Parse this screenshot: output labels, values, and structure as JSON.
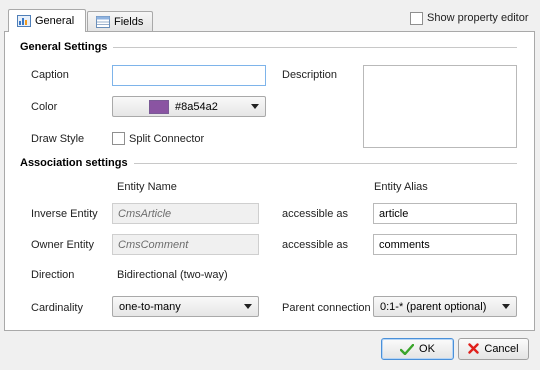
{
  "tabs": [
    {
      "label": "General",
      "active": true
    },
    {
      "label": "Fields",
      "active": false
    }
  ],
  "show_property_editor": {
    "label": "Show property editor",
    "checked": false
  },
  "general_settings": {
    "title": "General Settings",
    "caption_label": "Caption",
    "caption_value": "",
    "description_label": "Description",
    "description_value": "",
    "color_label": "Color",
    "color_value": "#8a54a2",
    "draw_style_label": "Draw Style",
    "split_connector_label": "Split Connector",
    "split_connector_checked": false
  },
  "association_settings": {
    "title": "Association settings",
    "entity_name_header": "Entity Name",
    "entity_alias_header": "Entity Alias",
    "inverse_entity_label": "Inverse Entity",
    "inverse_entity_value": "CmsArticle",
    "inverse_accessible_label": "accessible as",
    "inverse_alias_value": "article",
    "owner_entity_label": "Owner Entity",
    "owner_entity_value": "CmsComment",
    "owner_accessible_label": "accessible as",
    "owner_alias_value": "comments",
    "direction_label": "Direction",
    "direction_value": "Bidirectional (two-way)",
    "cardinality_label": "Cardinality",
    "cardinality_value": "one-to-many",
    "parent_connection_label": "Parent connection",
    "parent_connection_value": "0:1-* (parent optional)"
  },
  "buttons": {
    "ok_label": "OK",
    "cancel_label": "Cancel"
  },
  "colors": {
    "accent_color": "#8a54a2",
    "focus_border": "#7eb4ea",
    "ok_check": "#3aa52b",
    "cancel_x": "#e0201b"
  }
}
